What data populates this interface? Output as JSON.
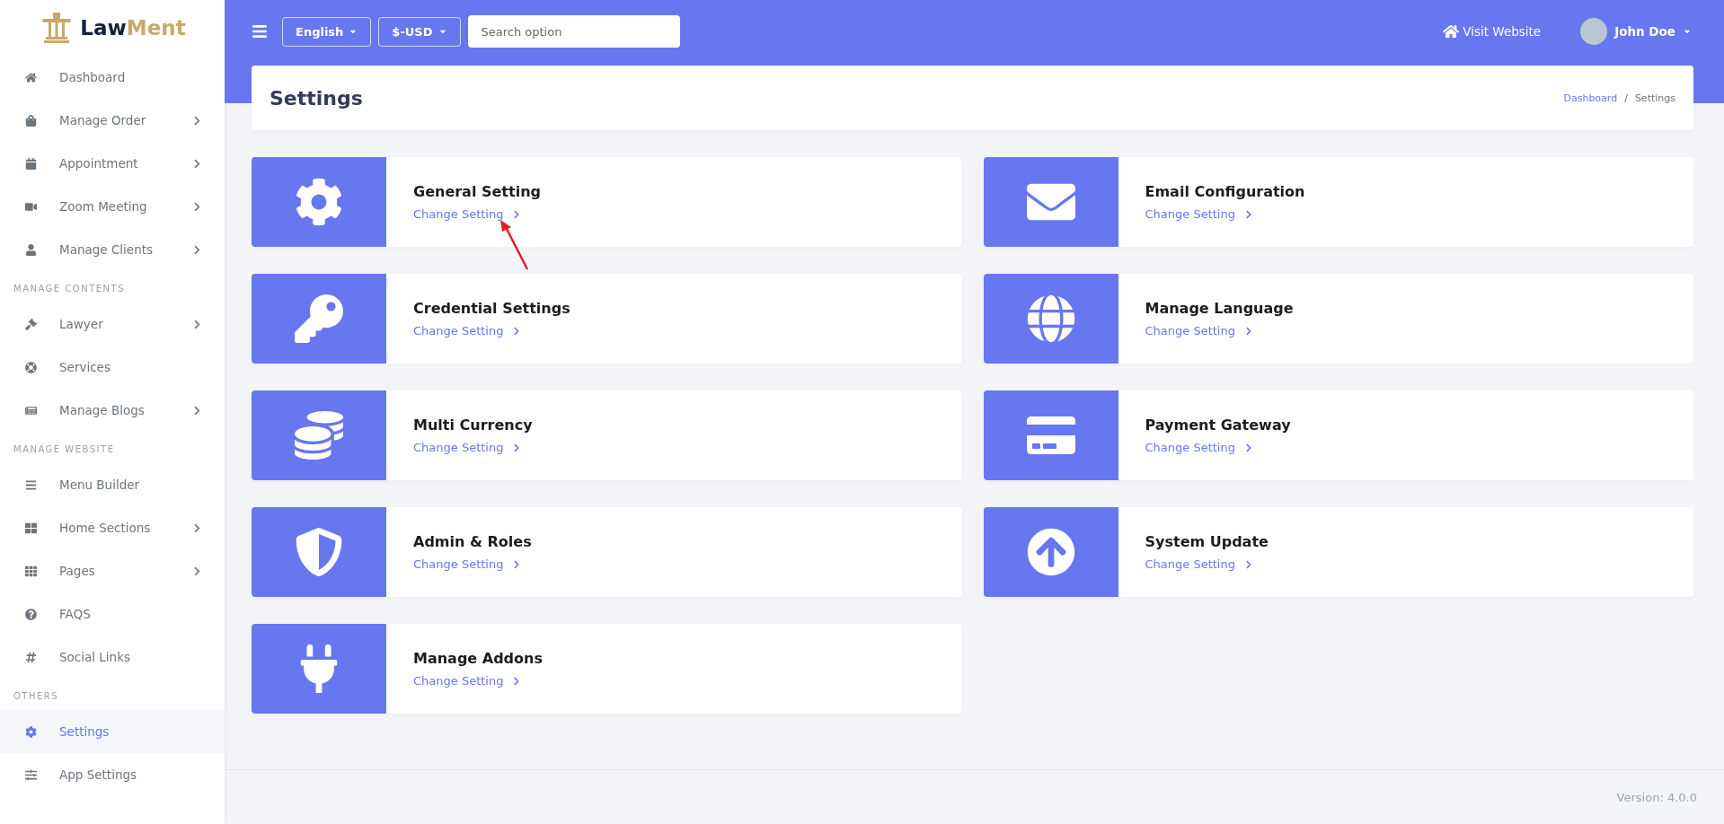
{
  "logo": {
    "part_1": "Law",
    "part_2": "Ment"
  },
  "sidebar": {
    "groups": [
      {
        "items": [
          {
            "label": "Dashboard",
            "has_submenu": false,
            "selected": false
          },
          {
            "label": "Manage Order",
            "has_submenu": true,
            "selected": false
          },
          {
            "label": "Appointment",
            "has_submenu": true,
            "selected": false
          },
          {
            "label": "Zoom Meeting",
            "has_submenu": true,
            "selected": false
          },
          {
            "label": "Manage Clients",
            "has_submenu": true,
            "selected": false
          }
        ]
      },
      {
        "heading": "MANAGE CONTENTS",
        "items": [
          {
            "label": "Lawyer",
            "has_submenu": true,
            "selected": false
          },
          {
            "label": "Services",
            "has_submenu": false,
            "selected": false
          },
          {
            "label": "Manage Blogs",
            "has_submenu": true,
            "selected": false
          }
        ]
      },
      {
        "heading": "MANAGE WEBSITE",
        "items": [
          {
            "label": "Menu Builder",
            "has_submenu": false,
            "selected": false
          },
          {
            "label": "Home Sections",
            "has_submenu": true,
            "selected": false
          },
          {
            "label": "Pages",
            "has_submenu": true,
            "selected": false
          },
          {
            "label": "FAQS",
            "has_submenu": false,
            "selected": false
          },
          {
            "label": "Social Links",
            "has_submenu": false,
            "selected": false
          }
        ]
      },
      {
        "heading": "OTHERS",
        "items": [
          {
            "label": "Settings",
            "has_submenu": false,
            "selected": true
          },
          {
            "label": "App Settings",
            "has_submenu": false,
            "selected": false
          }
        ]
      }
    ]
  },
  "topbar": {
    "language": "English",
    "currency": "$-USD",
    "search": {
      "placeholder": "Search option"
    },
    "visit_website": "Visit Website",
    "user": "John Doe"
  },
  "page_header": {
    "title": "Settings",
    "breadcrumb": [
      "Dashboard",
      "Settings"
    ],
    "breadcrumb_separator": "/"
  },
  "cards": [
    {
      "title": "General Setting",
      "link": "Change Setting"
    },
    {
      "title": "Email Configuration",
      "link": "Change Setting"
    },
    {
      "title": "Credential Settings",
      "link": "Change Setting"
    },
    {
      "title": "Manage Language",
      "link": "Change Setting"
    },
    {
      "title": "Multi Currency",
      "link": "Change Setting"
    },
    {
      "title": "Payment Gateway",
      "link": "Change Setting"
    },
    {
      "title": "Admin & Roles",
      "link": "Change Setting"
    },
    {
      "title": "System Update",
      "link": "Change Setting"
    },
    {
      "title": "Manage Addons",
      "link": "Change Setting"
    }
  ],
  "footer": {
    "version": "Version: 4.0.0"
  }
}
